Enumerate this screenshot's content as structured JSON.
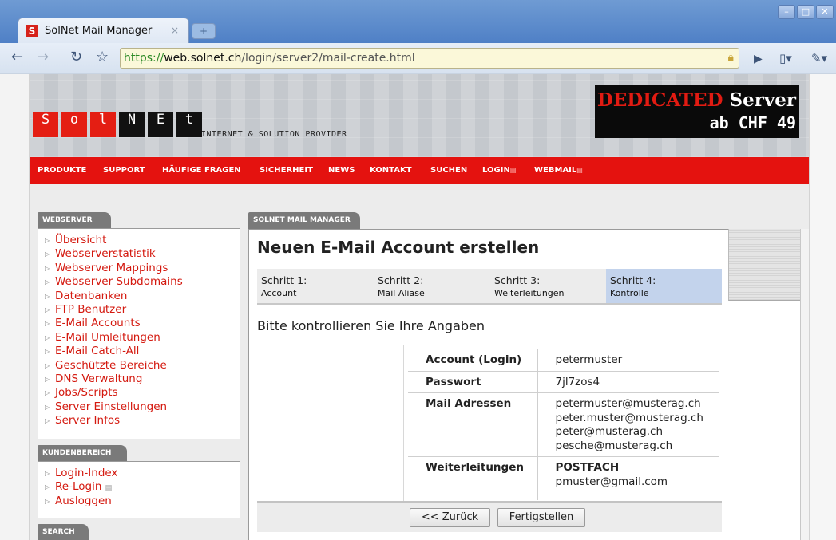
{
  "browser": {
    "tab_title": "SolNet Mail Manager",
    "tab_close": "×",
    "new_tab": "+",
    "url_scheme": "https://",
    "url_domain": "web.solnet.ch",
    "url_path": "/login/server2/mail-create.html",
    "win_minimize": "–",
    "win_maximize": "□",
    "win_close": "✕",
    "icons": [
      "back-icon",
      "forward-icon",
      "reload-icon",
      "bookmark-star-icon",
      "lock-icon",
      "go-icon",
      "page-menu-icon",
      "wrench-icon"
    ]
  },
  "header": {
    "logo_letters": [
      "S",
      "o",
      "l",
      "N",
      "E",
      "t"
    ],
    "tagline": "INTERNET & SOLUTION PROVIDER",
    "banner_red": "DEDICATED",
    "banner_white": "Server",
    "banner_line2": "ab CHF 49"
  },
  "nav": {
    "items": [
      "PRODUKTE",
      "SUPPORT",
      "HÄUFIGE FRAGEN",
      "SICHERHEIT",
      "NEWS",
      "KONTAKT",
      "SUCHEN",
      "LOGIN",
      "WEBMAIL"
    ],
    "ext_icon": "▤"
  },
  "sidebar": {
    "webserver_title": "WEBSERVER",
    "webserver_items": [
      "Übersicht",
      "Webserverstatistik",
      "Webserver Mappings",
      "Webserver Subdomains",
      "Datenbanken",
      "FTP Benutzer",
      "E-Mail Accounts",
      "E-Mail Umleitungen",
      "E-Mail Catch-All",
      "Geschützte Bereiche",
      "DNS Verwaltung",
      "Jobs/Scripts",
      "Server Einstellungen",
      "Server Infos"
    ],
    "kunden_title": "KUNDENBEREICH",
    "kunden_items": [
      "Login-Index",
      "Re-Login",
      "Ausloggen"
    ],
    "search_title": "SEARCH"
  },
  "main": {
    "tab_label": "SOLNET MAIL MANAGER",
    "heading": "Neuen E-Mail Account erstellen",
    "steps": [
      {
        "title": "Schritt 1:",
        "sub": "Account"
      },
      {
        "title": "Schritt 2:",
        "sub": "Mail Aliase"
      },
      {
        "title": "Schritt 3:",
        "sub": "Weiterleitungen"
      },
      {
        "title": "Schritt 4:",
        "sub": "Kontrolle"
      }
    ],
    "subheading": "Bitte kontrollieren Sie Ihre Angaben",
    "summary": {
      "account_label": "Account (Login)",
      "account_value": "petermuster",
      "password_label": "Passwort",
      "password_value": "7jl7zos4",
      "addresses_label": "Mail Adressen",
      "addresses": [
        "petermuster@musterag.ch",
        "peter.muster@musterag.ch",
        "peter@musterag.ch",
        "pesche@musterag.ch"
      ],
      "forward_label": "Weiterleitungen",
      "forwards": [
        "POSTFACH",
        "pmuster@gmail.com"
      ]
    },
    "back_button": "<< Zurück",
    "finish_button": "Fertigstellen"
  }
}
